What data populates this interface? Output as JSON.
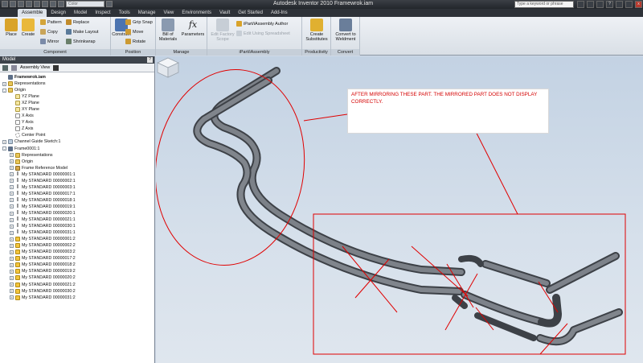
{
  "titlebar": {
    "app_title": "Autodesk Inventor 2010    Framewrok.iam",
    "color_combo": "Color",
    "search_placeholder": "Type a keyword or phrase",
    "help_label": "?",
    "close_label": "x"
  },
  "tabs": [
    "Assemble",
    "Design",
    "Model",
    "Inspect",
    "Tools",
    "Manage",
    "View",
    "Environments",
    "Vault",
    "Get Started",
    "Add-Ins"
  ],
  "ribbon": {
    "component": {
      "label": "Component",
      "place": "Place",
      "create": "Create",
      "pattern": "Pattern",
      "copy": "Copy",
      "mirror": "Mirror",
      "replace": "Replace",
      "make_layout": "Make Layout",
      "shrinkwrap": "Shrinkwrap"
    },
    "position": {
      "label": "Position",
      "constrain": "Constrain",
      "grip_snap": "Grip Snap",
      "move": "Move",
      "rotate": "Rotate"
    },
    "manage": {
      "label": "Manage",
      "bom_line1": "Bill of",
      "bom_line2": "Materials",
      "parameters": "Parameters"
    },
    "ipart": {
      "label": "iPart/iAssembly",
      "edit_factory_line1": "Edit Factory",
      "edit_factory_line2": "Scope",
      "author": "iPart/iAssembly Author",
      "edit_spreadsheet": "Edit Using Spreadsheet"
    },
    "productivity": {
      "label": "Productivity",
      "create_sub_line1": "Create",
      "create_sub_line2": "Substitutes"
    },
    "convert": {
      "label": "Convert",
      "convert_line1": "Convert to",
      "convert_line2": "Weldment"
    }
  },
  "browser": {
    "header": "Model",
    "help": "?",
    "view_combo": "Assembly View",
    "tree": [
      {
        "label": "Framewrok.iam",
        "depth": 0,
        "icon": "assy",
        "exp": "",
        "bold": true
      },
      {
        "label": "Representations",
        "depth": 0,
        "icon": "folder",
        "exp": "+"
      },
      {
        "label": "Origin",
        "depth": 0,
        "icon": "folder",
        "exp": "-"
      },
      {
        "label": "YZ Plane",
        "depth": 1,
        "icon": "plane",
        "exp": ""
      },
      {
        "label": "XZ Plane",
        "depth": 1,
        "icon": "plane",
        "exp": ""
      },
      {
        "label": "XY Plane",
        "depth": 1,
        "icon": "plane",
        "exp": ""
      },
      {
        "label": "X Axis",
        "depth": 1,
        "icon": "axis",
        "exp": ""
      },
      {
        "label": "Y Axis",
        "depth": 1,
        "icon": "axis",
        "exp": ""
      },
      {
        "label": "Z Axis",
        "depth": 1,
        "icon": "axis",
        "exp": ""
      },
      {
        "label": "Center Point",
        "depth": 1,
        "icon": "point",
        "exp": ""
      },
      {
        "label": "Channel Guide Sketch:1",
        "depth": 0,
        "icon": "sketch",
        "exp": "+"
      },
      {
        "label": "Frame0001:1",
        "depth": 0,
        "icon": "assy",
        "exp": "-"
      },
      {
        "label": "Representations",
        "depth": 1,
        "icon": "folder",
        "exp": "+"
      },
      {
        "label": "Origin",
        "depth": 1,
        "icon": "folder",
        "exp": "+"
      },
      {
        "label": "Frame Reference Model",
        "depth": 1,
        "icon": "refm",
        "exp": "+"
      },
      {
        "label": "My STANDARD  00000001:1",
        "depth": 1,
        "icon": "ibeam",
        "exp": "+"
      },
      {
        "label": "My STANDARD  00000002:1",
        "depth": 1,
        "icon": "ibeam",
        "exp": "+"
      },
      {
        "label": "My STANDARD  00000003:1",
        "depth": 1,
        "icon": "ibeam",
        "exp": "+"
      },
      {
        "label": "My STANDARD  00000017:1",
        "depth": 1,
        "icon": "ibeam",
        "exp": "+"
      },
      {
        "label": "My STANDARD  00000018:1",
        "depth": 1,
        "icon": "ibeam",
        "exp": "+"
      },
      {
        "label": "My STANDARD  00000019:1",
        "depth": 1,
        "icon": "ibeam",
        "exp": "+"
      },
      {
        "label": "My STANDARD  00000020:1",
        "depth": 1,
        "icon": "ibeam",
        "exp": "+"
      },
      {
        "label": "My STANDARD  00000021:1",
        "depth": 1,
        "icon": "ibeam",
        "exp": "+"
      },
      {
        "label": "My STANDARD  00000030:1",
        "depth": 1,
        "icon": "ibeam",
        "exp": "+"
      },
      {
        "label": "My STANDARD  00000031:1",
        "depth": 1,
        "icon": "ibeam",
        "exp": "+"
      },
      {
        "label": "My STANDARD  00000001:2",
        "depth": 1,
        "icon": "part",
        "exp": "+"
      },
      {
        "label": "My STANDARD  00000002:2",
        "depth": 1,
        "icon": "part",
        "exp": "+"
      },
      {
        "label": "My STANDARD  00000003:2",
        "depth": 1,
        "icon": "part",
        "exp": "+"
      },
      {
        "label": "My STANDARD  00000017:2",
        "depth": 1,
        "icon": "part",
        "exp": "+"
      },
      {
        "label": "My STANDARD  00000018:2",
        "depth": 1,
        "icon": "part",
        "exp": "+"
      },
      {
        "label": "My STANDARD  00000019:2",
        "depth": 1,
        "icon": "part",
        "exp": "+"
      },
      {
        "label": "My STANDARD  00000020:2",
        "depth": 1,
        "icon": "part",
        "exp": "+"
      },
      {
        "label": "My STANDARD  00000021:2",
        "depth": 1,
        "icon": "part",
        "exp": "+"
      },
      {
        "label": "My STANDARD  00000030:2",
        "depth": 1,
        "icon": "part",
        "exp": "+"
      },
      {
        "label": "My STANDARD  00000031:2",
        "depth": 1,
        "icon": "part",
        "exp": "+"
      }
    ]
  },
  "viewport": {
    "annotation": "AFTER MIRRORING THESE PART. THE MIRRORED PART DOES NOT DISPLAY CORRECTLY.",
    "markup_color": "#e00000"
  }
}
